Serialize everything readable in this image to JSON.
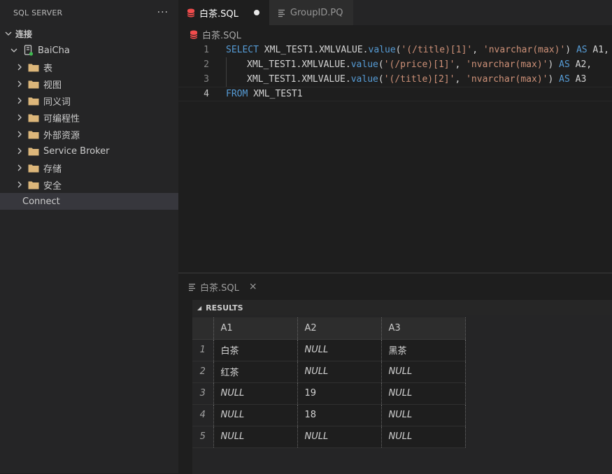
{
  "sidebar": {
    "title": "SQL SERVER",
    "more": "···",
    "section": "连接",
    "server": "BaiCha",
    "folders": [
      "表",
      "视图",
      "同义词",
      "可编程性",
      "外部资源",
      "Service Broker",
      "存储",
      "安全"
    ],
    "connect": "Connect"
  },
  "tabs": [
    {
      "label": "白茶.SQL",
      "icon": "database-icon",
      "dirty": true
    },
    {
      "label": "GroupID.PQ",
      "icon": "lines-icon"
    }
  ],
  "breadcrumb": "白茶.SQL",
  "code": {
    "line_numbers": [
      "1",
      "2",
      "3",
      "4"
    ],
    "l1": {
      "kw": "SELECT",
      "obj": "XML_TEST1.XMLVALUE.",
      "fn": "value",
      "open": "(",
      "s1": "'(/title)[1]'",
      "comma": ", ",
      "s2": "'nvarchar(max)'",
      "close": ") ",
      "as": "AS",
      "alias": " A1,"
    },
    "l2": {
      "obj": "XML_TEST1.XMLVALUE.",
      "fn": "value",
      "open": "(",
      "s1": "'(/price)[1]'",
      "comma": ", ",
      "s2": "'nvarchar(max)'",
      "close": ") ",
      "as": "AS",
      "alias": " A2,"
    },
    "l3": {
      "obj": "XML_TEST1.XMLVALUE.",
      "fn": "value",
      "open": "(",
      "s1": "'(/title)[2]'",
      "comma": ", ",
      "s2": "'nvarchar(max)'",
      "close": ") ",
      "as": "AS",
      "alias": " A3"
    },
    "l4": {
      "kw": "FROM",
      "obj": " XML_TEST1"
    }
  },
  "panel": {
    "tab_label": "白茶.SQL",
    "close": "×",
    "results_label": "RESULTS",
    "columns": [
      "A1",
      "A2",
      "A3"
    ],
    "rows": [
      {
        "n": "1",
        "a1": "白茶",
        "a2": "NULL",
        "a3": "黑茶"
      },
      {
        "n": "2",
        "a1": "红茶",
        "a2": "NULL",
        "a3": "NULL"
      },
      {
        "n": "3",
        "a1": "NULL",
        "a2": "19",
        "a3": "NULL"
      },
      {
        "n": "4",
        "a1": "NULL",
        "a2": "18",
        "a3": "NULL"
      },
      {
        "n": "5",
        "a1": "NULL",
        "a2": "NULL",
        "a3": "NULL"
      }
    ]
  },
  "colors": {
    "accent": "#007acc",
    "keyword": "#569cd6",
    "string": "#ce9178",
    "db_icon": "#f14c4c",
    "folder": "#dcb67a"
  }
}
